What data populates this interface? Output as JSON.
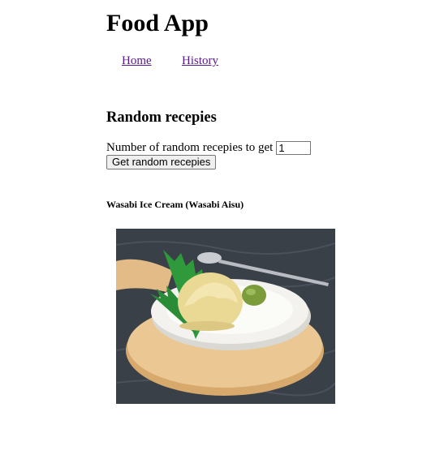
{
  "app": {
    "title": "Food App"
  },
  "nav": {
    "items": [
      {
        "label": "Home"
      },
      {
        "label": "History"
      }
    ]
  },
  "random_section": {
    "title": "Random recepies",
    "count_label": "Number of random recepies to get",
    "count_value": "1",
    "button_label": "Get random recepies"
  },
  "recipe": {
    "title": "Wasabi Ice Cream (Wasabi Aisu)",
    "image_alt": "Wasabi Ice Cream (Wasabi Aisu)"
  },
  "colors": {
    "visited_link": "#551a8b",
    "table_cloth": "#3a4048",
    "wood_tray": "#e6c08e",
    "plate": "#f2f1ec",
    "ice_cream": "#ecdc9c",
    "wasabi": "#7a9a3a",
    "leaf": "#2f9a3a"
  }
}
